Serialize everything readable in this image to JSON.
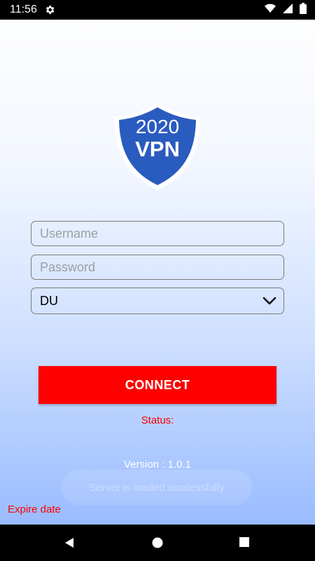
{
  "status_bar": {
    "time": "11:56",
    "icons": [
      "gear-icon",
      "wifi-icon",
      "signal-icon",
      "battery-icon"
    ]
  },
  "logo": {
    "year": "2020",
    "name": "VPN",
    "shield_color": "#2a5bbf"
  },
  "form": {
    "username_placeholder": "Username",
    "password_placeholder": "Password",
    "server_selected": "DU"
  },
  "connect_label": "CONNECT",
  "status_text": "Status:",
  "version_text": "Version : 1.0.1",
  "toast_text": "Server is loaded successfully",
  "expire_text": "Expire date",
  "colors": {
    "accent_red": "#ff0000",
    "gradient_top": "#ffffff",
    "gradient_bottom": "#8fb4ff"
  },
  "nav": [
    "back-icon",
    "home-icon",
    "recents-icon"
  ]
}
